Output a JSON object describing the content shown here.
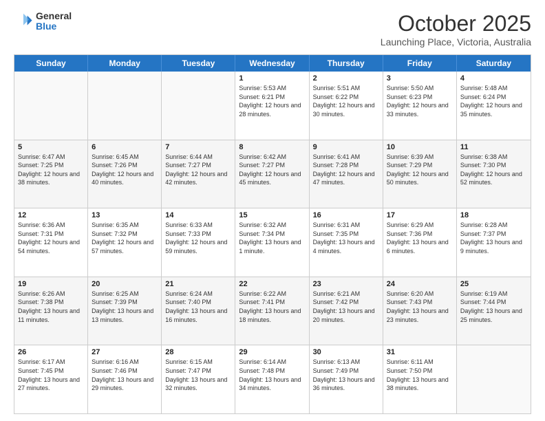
{
  "header": {
    "logo_general": "General",
    "logo_blue": "Blue",
    "month_title": "October 2025",
    "subtitle": "Launching Place, Victoria, Australia"
  },
  "weekdays": [
    "Sunday",
    "Monday",
    "Tuesday",
    "Wednesday",
    "Thursday",
    "Friday",
    "Saturday"
  ],
  "rows": [
    [
      {
        "day": "",
        "info": "",
        "empty": true
      },
      {
        "day": "",
        "info": "",
        "empty": true
      },
      {
        "day": "",
        "info": "",
        "empty": true
      },
      {
        "day": "1",
        "info": "Sunrise: 5:53 AM\nSunset: 6:21 PM\nDaylight: 12 hours\nand 28 minutes."
      },
      {
        "day": "2",
        "info": "Sunrise: 5:51 AM\nSunset: 6:22 PM\nDaylight: 12 hours\nand 30 minutes."
      },
      {
        "day": "3",
        "info": "Sunrise: 5:50 AM\nSunset: 6:23 PM\nDaylight: 12 hours\nand 33 minutes."
      },
      {
        "day": "4",
        "info": "Sunrise: 5:48 AM\nSunset: 6:24 PM\nDaylight: 12 hours\nand 35 minutes."
      }
    ],
    [
      {
        "day": "5",
        "info": "Sunrise: 6:47 AM\nSunset: 7:25 PM\nDaylight: 12 hours\nand 38 minutes."
      },
      {
        "day": "6",
        "info": "Sunrise: 6:45 AM\nSunset: 7:26 PM\nDaylight: 12 hours\nand 40 minutes."
      },
      {
        "day": "7",
        "info": "Sunrise: 6:44 AM\nSunset: 7:27 PM\nDaylight: 12 hours\nand 42 minutes."
      },
      {
        "day": "8",
        "info": "Sunrise: 6:42 AM\nSunset: 7:27 PM\nDaylight: 12 hours\nand 45 minutes."
      },
      {
        "day": "9",
        "info": "Sunrise: 6:41 AM\nSunset: 7:28 PM\nDaylight: 12 hours\nand 47 minutes."
      },
      {
        "day": "10",
        "info": "Sunrise: 6:39 AM\nSunset: 7:29 PM\nDaylight: 12 hours\nand 50 minutes."
      },
      {
        "day": "11",
        "info": "Sunrise: 6:38 AM\nSunset: 7:30 PM\nDaylight: 12 hours\nand 52 minutes."
      }
    ],
    [
      {
        "day": "12",
        "info": "Sunrise: 6:36 AM\nSunset: 7:31 PM\nDaylight: 12 hours\nand 54 minutes."
      },
      {
        "day": "13",
        "info": "Sunrise: 6:35 AM\nSunset: 7:32 PM\nDaylight: 12 hours\nand 57 minutes."
      },
      {
        "day": "14",
        "info": "Sunrise: 6:33 AM\nSunset: 7:33 PM\nDaylight: 12 hours\nand 59 minutes."
      },
      {
        "day": "15",
        "info": "Sunrise: 6:32 AM\nSunset: 7:34 PM\nDaylight: 13 hours\nand 1 minute."
      },
      {
        "day": "16",
        "info": "Sunrise: 6:31 AM\nSunset: 7:35 PM\nDaylight: 13 hours\nand 4 minutes."
      },
      {
        "day": "17",
        "info": "Sunrise: 6:29 AM\nSunset: 7:36 PM\nDaylight: 13 hours\nand 6 minutes."
      },
      {
        "day": "18",
        "info": "Sunrise: 6:28 AM\nSunset: 7:37 PM\nDaylight: 13 hours\nand 9 minutes."
      }
    ],
    [
      {
        "day": "19",
        "info": "Sunrise: 6:26 AM\nSunset: 7:38 PM\nDaylight: 13 hours\nand 11 minutes."
      },
      {
        "day": "20",
        "info": "Sunrise: 6:25 AM\nSunset: 7:39 PM\nDaylight: 13 hours\nand 13 minutes."
      },
      {
        "day": "21",
        "info": "Sunrise: 6:24 AM\nSunset: 7:40 PM\nDaylight: 13 hours\nand 16 minutes."
      },
      {
        "day": "22",
        "info": "Sunrise: 6:22 AM\nSunset: 7:41 PM\nDaylight: 13 hours\nand 18 minutes."
      },
      {
        "day": "23",
        "info": "Sunrise: 6:21 AM\nSunset: 7:42 PM\nDaylight: 13 hours\nand 20 minutes."
      },
      {
        "day": "24",
        "info": "Sunrise: 6:20 AM\nSunset: 7:43 PM\nDaylight: 13 hours\nand 23 minutes."
      },
      {
        "day": "25",
        "info": "Sunrise: 6:19 AM\nSunset: 7:44 PM\nDaylight: 13 hours\nand 25 minutes."
      }
    ],
    [
      {
        "day": "26",
        "info": "Sunrise: 6:17 AM\nSunset: 7:45 PM\nDaylight: 13 hours\nand 27 minutes."
      },
      {
        "day": "27",
        "info": "Sunrise: 6:16 AM\nSunset: 7:46 PM\nDaylight: 13 hours\nand 29 minutes."
      },
      {
        "day": "28",
        "info": "Sunrise: 6:15 AM\nSunset: 7:47 PM\nDaylight: 13 hours\nand 32 minutes."
      },
      {
        "day": "29",
        "info": "Sunrise: 6:14 AM\nSunset: 7:48 PM\nDaylight: 13 hours\nand 34 minutes."
      },
      {
        "day": "30",
        "info": "Sunrise: 6:13 AM\nSunset: 7:49 PM\nDaylight: 13 hours\nand 36 minutes."
      },
      {
        "day": "31",
        "info": "Sunrise: 6:11 AM\nSunset: 7:50 PM\nDaylight: 13 hours\nand 38 minutes."
      },
      {
        "day": "",
        "info": "",
        "empty": true
      }
    ]
  ]
}
